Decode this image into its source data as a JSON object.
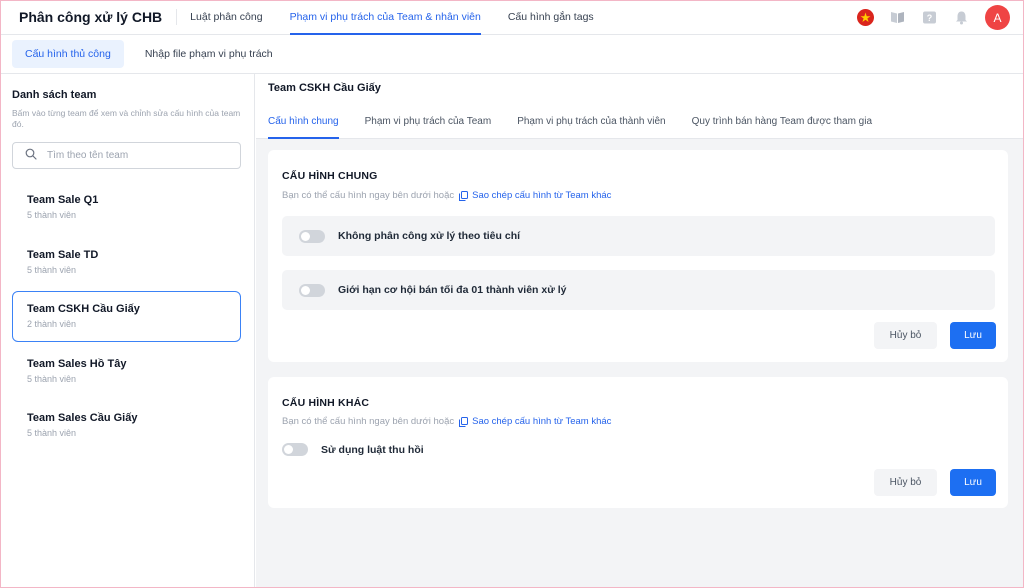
{
  "app": {
    "title": "Phân công xử lý CHB"
  },
  "top_nav": [
    {
      "label": "Luật phân công",
      "active": false
    },
    {
      "label": "Phạm vi phụ trách của Team & nhân viên",
      "active": true
    },
    {
      "label": "Cấu hình gắn tags",
      "active": false
    }
  ],
  "top_icons": [
    "vietnam-flag-icon",
    "book-icon",
    "help-icon",
    "bell-icon"
  ],
  "user": {
    "avatar_initial": "A",
    "avatar_color": "#ef4444"
  },
  "sub_tabs": [
    {
      "label": "Cấu hình thủ công",
      "active": true
    },
    {
      "label": "Nhập file phạm vi phụ trách",
      "active": false
    }
  ],
  "sidebar": {
    "title": "Danh sách team",
    "description": "Bấm vào từng team để xem và chỉnh sửa cấu hình của team đó.",
    "search_placeholder": "Tìm theo tên team",
    "teams": [
      {
        "name": "Team Sale Q1",
        "members": "5 thành viên",
        "selected": false
      },
      {
        "name": "Team Sale TD",
        "members": "5 thành viên",
        "selected": false
      },
      {
        "name": "Team CSKH Cầu Giấy",
        "members": "2 thành viên",
        "selected": true
      },
      {
        "name": "Team Sales Hồ Tây",
        "members": "5 thành viên",
        "selected": false
      },
      {
        "name": "Team Sales Cầu Giấy",
        "members": "5 thành viên",
        "selected": false
      }
    ]
  },
  "main": {
    "team_title": "Team CSKH Cầu Giấy",
    "tabs": [
      {
        "label": "Cấu hình chung",
        "active": true
      },
      {
        "label": "Phạm vi phụ trách của Team",
        "active": false
      },
      {
        "label": "Phạm vi phụ trách của thành viên",
        "active": false
      },
      {
        "label": "Quy trình bán hàng Team được tham gia",
        "active": false
      }
    ],
    "general_card": {
      "title": "CẤU HÌNH CHUNG",
      "subtitle": "Bạn có thể cấu hình ngay bên dưới hoặc",
      "copy_link": "Sao chép cấu hình từ Team khác",
      "criteria": [
        {
          "label": "Không phân công xử lý theo tiêu chí",
          "enabled": false
        },
        {
          "label": "Giới hạn cơ hội bán tối đa 01 thành viên xử lý",
          "enabled": false
        }
      ],
      "cancel_label": "Hủy bỏ",
      "save_label": "Lưu"
    },
    "other_card": {
      "title": "CẤU HÌNH KHÁC",
      "subtitle": "Bạn có thể cấu hình ngay bên dưới hoặc",
      "copy_link": "Sao chép cấu hình từ Team khác",
      "option": {
        "label": "Sử dụng luật thu hồi",
        "enabled": false
      },
      "cancel_label": "Hủy bỏ",
      "save_label": "Lưu"
    }
  },
  "colors": {
    "accent": "#2563eb",
    "save_button": "#1d6ff2",
    "selected_border": "#3b82f6"
  }
}
